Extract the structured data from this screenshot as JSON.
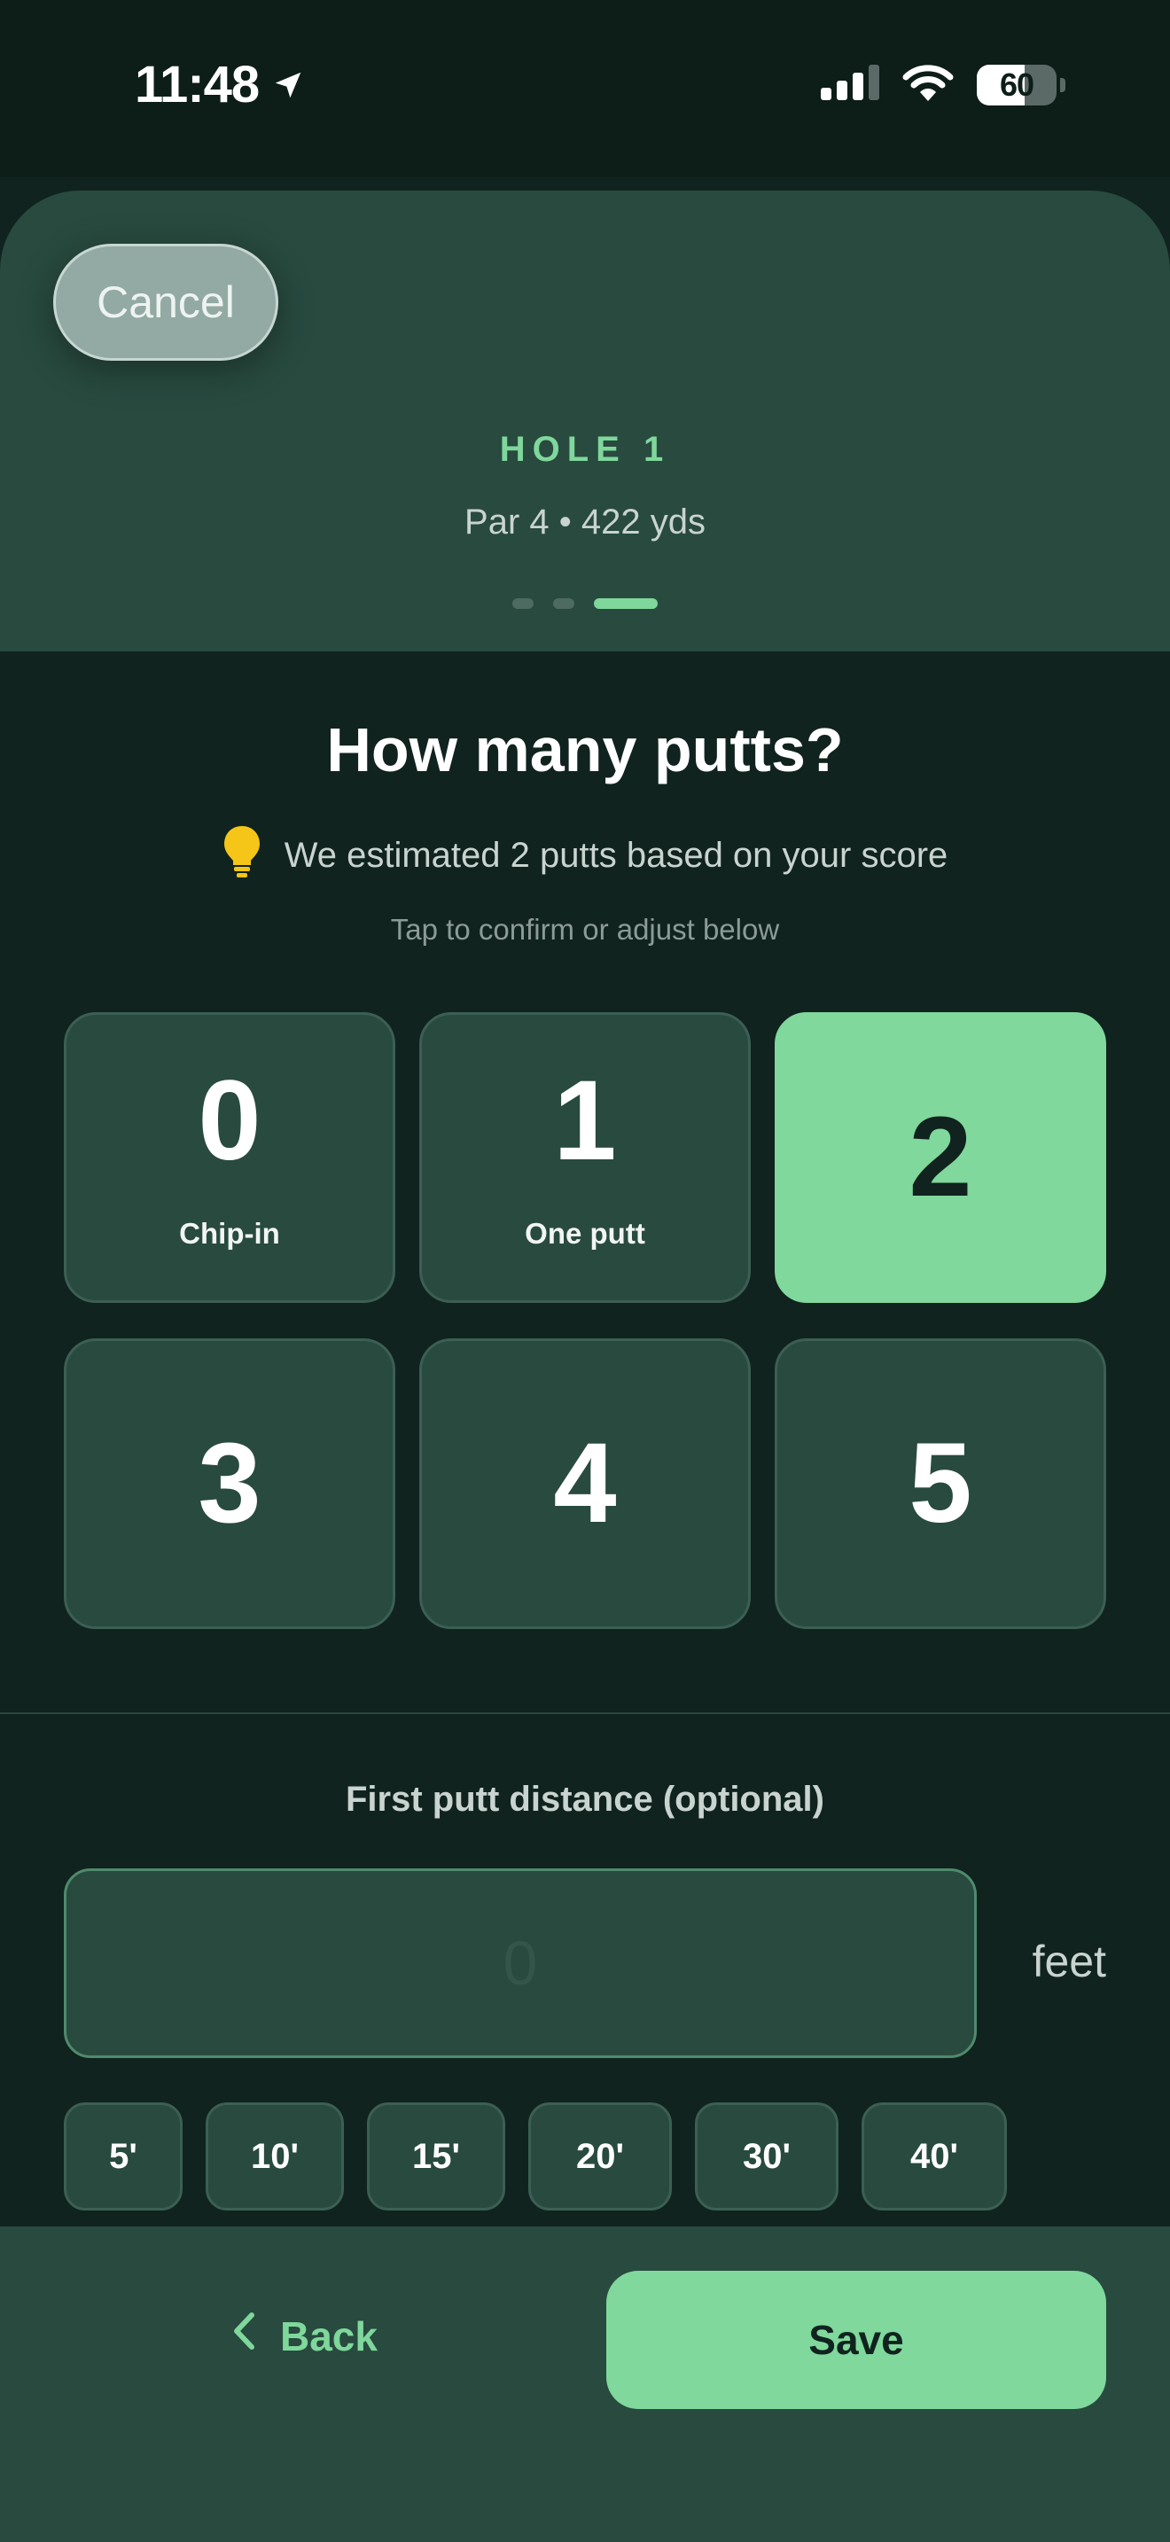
{
  "status_bar": {
    "time": "11:48",
    "battery_level": "60",
    "battery_fraction": 0.6,
    "icons": [
      "location-arrow-icon",
      "cellular-signal-icon",
      "wifi-icon",
      "battery-icon"
    ]
  },
  "header": {
    "cancel_label": "Cancel",
    "hole_label": "HOLE 1",
    "hole_info": "Par 4 • 422 yds",
    "steps_total": 3,
    "current_step": 3
  },
  "putts": {
    "question": "How many putts?",
    "estimate_icon": "lightbulb-icon",
    "estimate_text": "We estimated 2 putts based on your score",
    "hint": "Tap to confirm or adjust below",
    "selected": 2,
    "options": [
      {
        "value": "0",
        "sublabel": "Chip-in"
      },
      {
        "value": "1",
        "sublabel": "One putt"
      },
      {
        "value": "2",
        "sublabel": ""
      },
      {
        "value": "3",
        "sublabel": ""
      },
      {
        "value": "4",
        "sublabel": ""
      },
      {
        "value": "5",
        "sublabel": ""
      }
    ]
  },
  "distance": {
    "label": "First putt distance (optional)",
    "value": "",
    "placeholder": "0",
    "unit": "feet",
    "quick_options": [
      "5'",
      "10'",
      "15'",
      "20'",
      "30'",
      "40'"
    ]
  },
  "footer": {
    "back_label": "Back",
    "save_label": "Save"
  },
  "colors": {
    "accent": "#80d89c",
    "background": "#10231e",
    "card": "#284a3f",
    "bulb": "#f5c518"
  }
}
